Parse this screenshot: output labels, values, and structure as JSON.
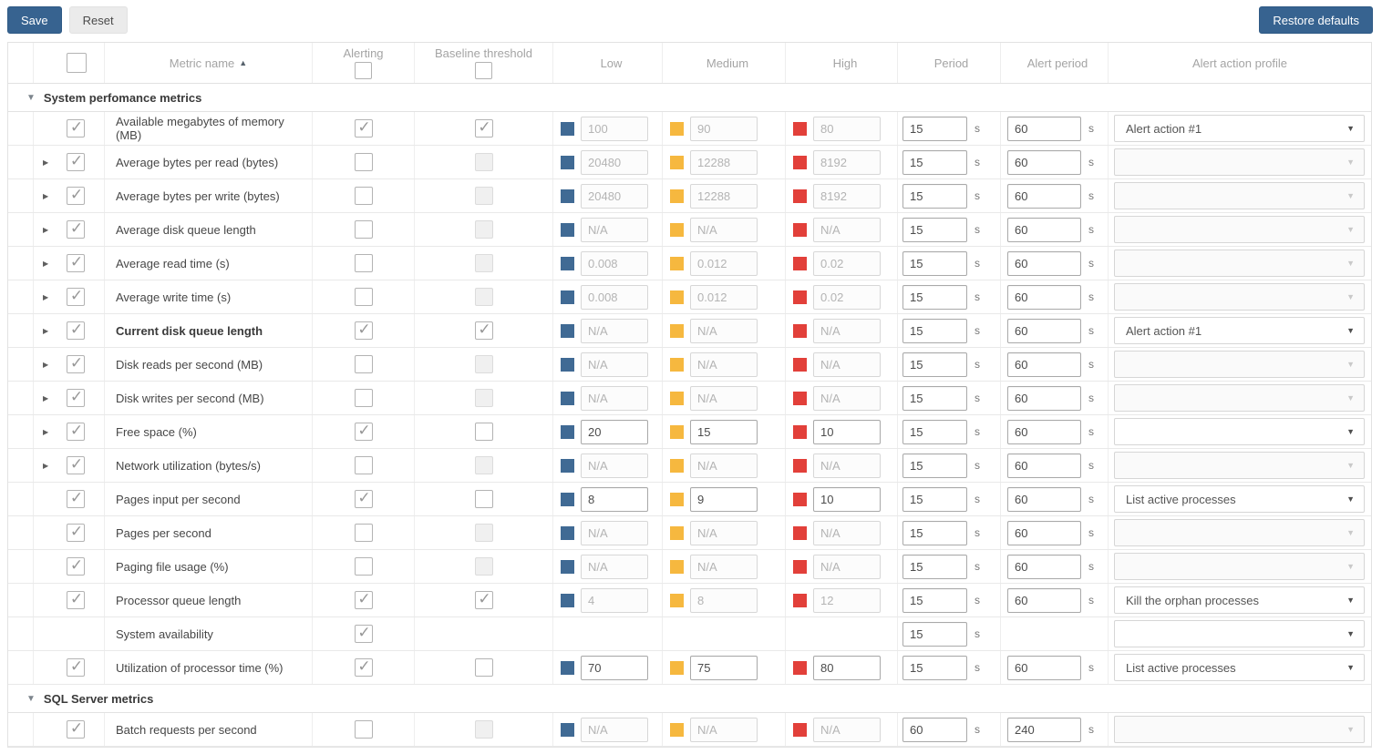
{
  "toolbar": {
    "save": "Save",
    "reset": "Reset",
    "restore": "Restore defaults"
  },
  "header": {
    "metric_name": "Metric name",
    "alerting": "Alerting",
    "baseline": "Baseline threshold",
    "low": "Low",
    "medium": "Medium",
    "high": "High",
    "period": "Period",
    "alert_period": "Alert period",
    "action": "Alert action profile",
    "seconds_suffix": "s"
  },
  "icons": {
    "check": "✓",
    "expand": "▶",
    "collapse": "▼",
    "sort_asc": "▲",
    "dropdown": "▼"
  },
  "colors": {
    "accent_blue": "#376390",
    "low_swatch": "#406a94",
    "medium_swatch": "#f6b83f",
    "high_swatch": "#e2403a"
  },
  "groups": [
    {
      "label": "System perfomance metrics",
      "rows": [
        {
          "name": "Available megabytes of memory (MB)",
          "bold": false,
          "expand": false,
          "selected": true,
          "alerting": "checked",
          "baseline": "checked",
          "thresholds": "disabled",
          "low": "100",
          "medium": "90",
          "high": "80",
          "period": "15",
          "alert_period": "60",
          "action": "Alert action #1",
          "action_state": "enabled"
        },
        {
          "name": "Average bytes per read (bytes)",
          "bold": false,
          "expand": true,
          "selected": true,
          "alerting": "unchecked",
          "baseline": "disabled",
          "thresholds": "disabled",
          "low": "20480",
          "medium": "12288",
          "high": "8192",
          "period": "15",
          "alert_period": "60",
          "action": "",
          "action_state": "disabled"
        },
        {
          "name": "Average bytes per write (bytes)",
          "bold": false,
          "expand": true,
          "selected": true,
          "alerting": "unchecked",
          "baseline": "disabled",
          "thresholds": "disabled",
          "low": "20480",
          "medium": "12288",
          "high": "8192",
          "period": "15",
          "alert_period": "60",
          "action": "",
          "action_state": "disabled"
        },
        {
          "name": "Average disk queue length",
          "bold": false,
          "expand": true,
          "selected": true,
          "alerting": "unchecked",
          "baseline": "disabled",
          "thresholds": "disabled",
          "low": "N/A",
          "medium": "N/A",
          "high": "N/A",
          "period": "15",
          "alert_period": "60",
          "action": "",
          "action_state": "disabled"
        },
        {
          "name": "Average read time (s)",
          "bold": false,
          "expand": true,
          "selected": true,
          "alerting": "unchecked",
          "baseline": "disabled",
          "thresholds": "disabled",
          "low": "0.008",
          "medium": "0.012",
          "high": "0.02",
          "period": "15",
          "alert_period": "60",
          "action": "",
          "action_state": "disabled"
        },
        {
          "name": "Average write time (s)",
          "bold": false,
          "expand": true,
          "selected": true,
          "alerting": "unchecked",
          "baseline": "disabled",
          "thresholds": "disabled",
          "low": "0.008",
          "medium": "0.012",
          "high": "0.02",
          "period": "15",
          "alert_period": "60",
          "action": "",
          "action_state": "disabled"
        },
        {
          "name": "Current disk queue length",
          "bold": true,
          "expand": true,
          "selected": true,
          "alerting": "checked",
          "baseline": "checked",
          "thresholds": "disabled",
          "low": "N/A",
          "medium": "N/A",
          "high": "N/A",
          "period": "15",
          "alert_period": "60",
          "action": "Alert action #1",
          "action_state": "enabled"
        },
        {
          "name": "Disk reads per second (MB)",
          "bold": false,
          "expand": true,
          "selected": true,
          "alerting": "unchecked",
          "baseline": "disabled",
          "thresholds": "disabled",
          "low": "N/A",
          "medium": "N/A",
          "high": "N/A",
          "period": "15",
          "alert_period": "60",
          "action": "",
          "action_state": "disabled"
        },
        {
          "name": "Disk writes per second (MB)",
          "bold": false,
          "expand": true,
          "selected": true,
          "alerting": "unchecked",
          "baseline": "disabled",
          "thresholds": "disabled",
          "low": "N/A",
          "medium": "N/A",
          "high": "N/A",
          "period": "15",
          "alert_period": "60",
          "action": "",
          "action_state": "disabled"
        },
        {
          "name": "Free space (%)",
          "bold": false,
          "expand": true,
          "selected": true,
          "alerting": "checked",
          "baseline": "unchecked",
          "thresholds": "enabled",
          "low": "20",
          "medium": "15",
          "high": "10",
          "period": "15",
          "alert_period": "60",
          "action": "",
          "action_state": "enabled"
        },
        {
          "name": "Network utilization (bytes/s)",
          "bold": false,
          "expand": true,
          "selected": true,
          "alerting": "unchecked",
          "baseline": "disabled",
          "thresholds": "disabled",
          "low": "N/A",
          "medium": "N/A",
          "high": "N/A",
          "period": "15",
          "alert_period": "60",
          "action": "",
          "action_state": "disabled"
        },
        {
          "name": "Pages input per second",
          "bold": false,
          "expand": false,
          "selected": true,
          "alerting": "checked",
          "baseline": "unchecked",
          "thresholds": "enabled",
          "low": "8",
          "medium": "9",
          "high": "10",
          "period": "15",
          "alert_period": "60",
          "action": "List active processes",
          "action_state": "enabled"
        },
        {
          "name": "Pages per second",
          "bold": false,
          "expand": false,
          "selected": true,
          "alerting": "unchecked",
          "baseline": "disabled",
          "thresholds": "disabled",
          "low": "N/A",
          "medium": "N/A",
          "high": "N/A",
          "period": "15",
          "alert_period": "60",
          "action": "",
          "action_state": "disabled"
        },
        {
          "name": "Paging file usage (%)",
          "bold": false,
          "expand": false,
          "selected": true,
          "alerting": "unchecked",
          "baseline": "disabled",
          "thresholds": "disabled",
          "low": "N/A",
          "medium": "N/A",
          "high": "N/A",
          "period": "15",
          "alert_period": "60",
          "action": "",
          "action_state": "disabled"
        },
        {
          "name": "Processor queue length",
          "bold": false,
          "expand": false,
          "selected": true,
          "alerting": "checked",
          "baseline": "checked",
          "thresholds": "disabled",
          "low": "4",
          "medium": "8",
          "high": "12",
          "period": "15",
          "alert_period": "60",
          "action": "Kill the orphan processes",
          "action_state": "enabled"
        },
        {
          "name": "System availability",
          "bold": false,
          "expand": false,
          "selected": null,
          "alerting": "checked",
          "baseline": "none",
          "thresholds": "none",
          "low": null,
          "medium": null,
          "high": null,
          "period": "15",
          "alert_period": null,
          "action": "",
          "action_state": "enabled"
        },
        {
          "name": "Utilization of processor time (%)",
          "bold": false,
          "expand": false,
          "selected": true,
          "alerting": "checked",
          "baseline": "unchecked",
          "thresholds": "enabled",
          "low": "70",
          "medium": "75",
          "high": "80",
          "period": "15",
          "alert_period": "60",
          "action": "List active processes",
          "action_state": "enabled"
        }
      ]
    },
    {
      "label": "SQL Server metrics",
      "rows": [
        {
          "name": "Batch requests per second",
          "bold": false,
          "expand": false,
          "selected": true,
          "alerting": "unchecked",
          "baseline": "disabled",
          "thresholds": "disabled",
          "low": "N/A",
          "medium": "N/A",
          "high": "N/A",
          "period": "60",
          "alert_period": "240",
          "action": "",
          "action_state": "disabled"
        }
      ]
    }
  ]
}
